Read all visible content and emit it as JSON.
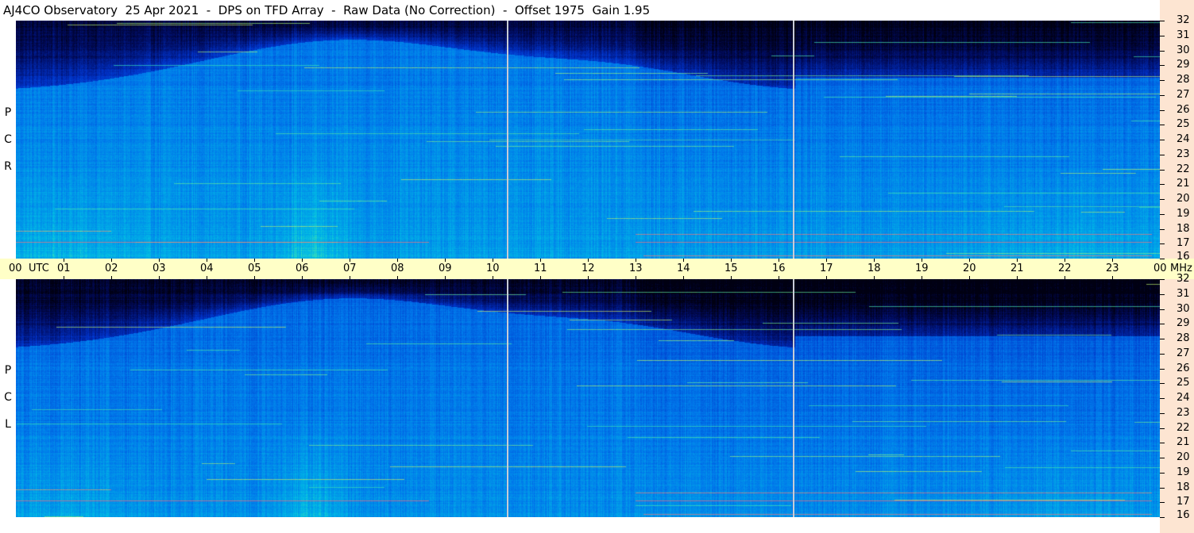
{
  "title": "AJ4CO Observatory  25 Apr 2021  -  DPS on TFD Array  -  Raw Data (No Correction)  -  Offset 1975  Gain 1.95",
  "panels": [
    {
      "name": "RCP",
      "letters": [
        "R",
        "C",
        "P"
      ]
    },
    {
      "name": "LCP",
      "letters": [
        "L",
        "C",
        "P"
      ]
    }
  ],
  "time_axis": {
    "unit_label": "UTC",
    "labels": [
      "00",
      "01",
      "02",
      "03",
      "04",
      "05",
      "06",
      "07",
      "08",
      "09",
      "10",
      "11",
      "12",
      "13",
      "14",
      "15",
      "16",
      "17",
      "18",
      "19",
      "20",
      "21",
      "22",
      "23",
      "00"
    ]
  },
  "freq_axis": {
    "unit_label": "MHz",
    "labels": [
      "32",
      "31",
      "30",
      "29",
      "28",
      "27",
      "26",
      "25",
      "24",
      "23",
      "22",
      "21",
      "20",
      "19",
      "18",
      "17",
      "16"
    ]
  },
  "colors": {
    "title_bg": "#ffffff",
    "time_band": "#ffffc7",
    "right_band": "#fde5d2",
    "colormap": [
      "#000020",
      "#001a8c",
      "#0050dc",
      "#0094f0",
      "#20d4c8",
      "#c8f070",
      "#ff7070"
    ]
  },
  "chart_data": {
    "type": "heatmap",
    "title": "AJ4CO Observatory  25 Apr 2021  -  DPS on TFD Array  -  Raw Data (No Correction)  -  Offset 1975  Gain 1.95",
    "x_range": [
      "00 UTC",
      "00 UTC"
    ],
    "y_range_mhz": [
      16,
      32
    ],
    "series": [
      {
        "name": "RCP",
        "polarization": "R C P"
      },
      {
        "name": "LCP",
        "polarization": "L C P"
      }
    ],
    "colormap": "dark blue (low) → cyan → yellow/red (high)"
  }
}
